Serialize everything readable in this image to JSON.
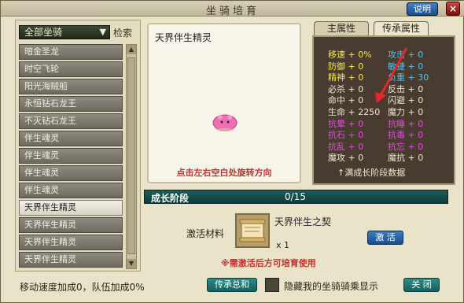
{
  "window": {
    "title": "坐骑培育",
    "help_label": "说明",
    "close_x": "×"
  },
  "left": {
    "filter_value": "全部坐骑",
    "search_label": "检索",
    "items": [
      {
        "label": "暗金圣龙"
      },
      {
        "label": "时空飞轮"
      },
      {
        "label": "阳光海贼船"
      },
      {
        "label": "永恒钻石龙王"
      },
      {
        "label": "不灭钻石龙王"
      },
      {
        "label": "伴生魂灵"
      },
      {
        "label": "伴生魂灵"
      },
      {
        "label": "伴生魂灵"
      },
      {
        "label": "伴生魂灵"
      },
      {
        "label": "天界伴生精灵",
        "selected": true
      },
      {
        "label": "天界伴生精灵"
      },
      {
        "label": "天界伴生精灵"
      },
      {
        "label": "天界伴生精灵"
      }
    ]
  },
  "preview": {
    "name": "天界伴生精灵",
    "hint": "点击左右空白处旋转方向"
  },
  "tabs": [
    {
      "label": "主属性"
    },
    {
      "label": "传承属性",
      "active": true
    }
  ],
  "attributes": {
    "col1": [
      {
        "text": "移速 + 0%",
        "color": "#f7e84a"
      },
      {
        "text": "防御 + 0",
        "color": "#f7e84a"
      },
      {
        "text": "精神 + 0",
        "color": "#f7e84a"
      },
      {
        "text": "必杀 + 0",
        "color": "#f0ead0"
      },
      {
        "text": "命中 + 0",
        "color": "#f0ead0"
      },
      {
        "text": "生命 + 2250",
        "color": "#f0ead0"
      },
      {
        "text": "抗晕 + 0",
        "color": "#e34be3"
      },
      {
        "text": "抗石 + 0",
        "color": "#e34be3"
      },
      {
        "text": "抗乱 + 0",
        "color": "#e34be3"
      },
      {
        "text": "魔攻 + 0",
        "color": "#f0ead0"
      }
    ],
    "col2": [
      {
        "text": "攻击 + 0",
        "color": "#4ec4f0"
      },
      {
        "text": "敏捷 + 0",
        "color": "#4ec4f0"
      },
      {
        "text": "负重 + 30",
        "color": "#4ec4f0"
      },
      {
        "text": "反击 + 0",
        "color": "#f0ead0"
      },
      {
        "text": "闪避 + 0",
        "color": "#f0ead0"
      },
      {
        "text": "魔力 + 0",
        "color": "#f0ead0"
      },
      {
        "text": "抗睡 + 0",
        "color": "#e34be3"
      },
      {
        "text": "抗毒 + 0",
        "color": "#e34be3"
      },
      {
        "text": "抗忘 + 0",
        "color": "#e34be3"
      },
      {
        "text": "魔抗 + 0",
        "color": "#f0ead0"
      }
    ],
    "footer": "↑满成长阶段数据"
  },
  "stage": {
    "label": "成长阶段",
    "value": "0/15"
  },
  "material": {
    "label": "激活材料",
    "name": "天界伴生之契",
    "count": "x 1",
    "activate_label": "激 活",
    "note": "※需激活后方可培育使用"
  },
  "bottom": {
    "status": "移动速度加成0，队伍加成0%",
    "inherit_label": "传承总和",
    "hide_label": "隐藏我的坐骑骑乘显示",
    "close_label": "关 闭"
  }
}
